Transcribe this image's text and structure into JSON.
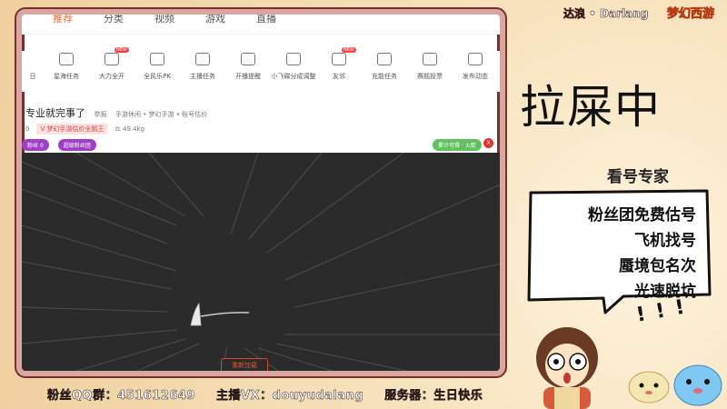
{
  "top_nav": {
    "tabs": [
      "推荐",
      "分类",
      "视频",
      "游戏",
      "直播"
    ]
  },
  "toolbar": {
    "items": [
      {
        "label": "日",
        "icon": "calendar-icon",
        "badge": ""
      },
      {
        "label": "星海任务",
        "icon": "ad-icon",
        "badge": ""
      },
      {
        "label": "大力全开",
        "icon": "fire-icon",
        "badge": "NEW"
      },
      {
        "label": "全民乐PK",
        "icon": "pk-icon",
        "badge": ""
      },
      {
        "label": "主播任务",
        "icon": "task-icon",
        "badge": ""
      },
      {
        "label": "开播提醒",
        "icon": "alarm-icon",
        "badge": ""
      },
      {
        "label": "小飞碟分成调整",
        "icon": "ufo-icon",
        "badge": ""
      },
      {
        "label": "友邻",
        "icon": "friends-icon",
        "badge": "NEW"
      },
      {
        "label": "充能任务",
        "icon": "gauge-icon",
        "badge": ""
      },
      {
        "label": "赛题投票",
        "icon": "vote-icon",
        "badge": ""
      },
      {
        "label": "发布动态",
        "icon": "edit-icon",
        "badge": ""
      }
    ]
  },
  "stream": {
    "title": "专业就完事了",
    "report": "举报",
    "breadcrumb": "手游休闲 • 梦幻手游 • 账号估价",
    "count_zero": "0",
    "tag": "V 梦幻手游估价全鹅王",
    "weight": "49.4kg",
    "fan_label": "粉丝",
    "fan_count": "0",
    "super_fan": "超级粉丝团",
    "cumulative_btn": "累计可得 · 火箭",
    "badge_x": "X",
    "refresh": "重新加载"
  },
  "overlay": {
    "brand": "达浪 • Darlang",
    "game_logo": "梦幻西游",
    "status": "拉屎中",
    "expert_title": "看号专家",
    "bubble_lines": [
      "粉丝团免费估号",
      "飞机找号",
      "蜃境包名次",
      "光速脱坑"
    ],
    "exclaim": "! ! !",
    "ticker": [
      "粉丝QQ群：451612649",
      "主播VX：douyudalang",
      "服务器：生日快乐"
    ]
  },
  "colors": {
    "accent": "#ff6a2b",
    "frame_border": "#d8a7a0",
    "video_bg": "#2b2b2b"
  }
}
